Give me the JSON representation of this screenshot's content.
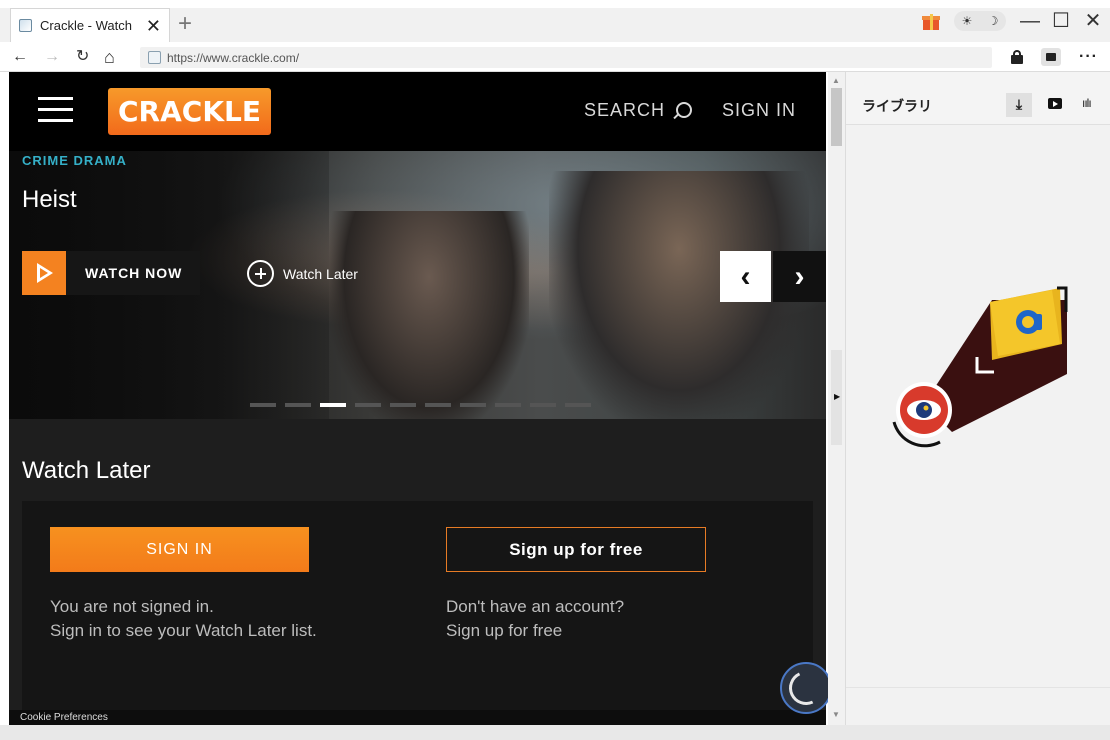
{
  "browser": {
    "tab_title": "Crackle - Watch",
    "tab_close": "✕",
    "new_tab": "+",
    "url": "https://www.crackle.com/",
    "theme_sun": "☀",
    "theme_moon": "☽",
    "win_min": "—",
    "win_max": "☐",
    "win_close": "✕",
    "more": "···",
    "nav_back": "←",
    "nav_forward": "→",
    "nav_reload": "↻",
    "nav_home": "⌂"
  },
  "site": {
    "logo": "CRACKLE",
    "search_label": "SEARCH",
    "signin_label": "SIGN IN"
  },
  "hero": {
    "genre": "CRIME DRAMA",
    "title": "Heist",
    "watch_now": "WATCH NOW",
    "watch_later": "Watch Later",
    "prev": "‹",
    "next": "›",
    "slide_count": 10,
    "active_slide": 3
  },
  "watch_later": {
    "heading": "Watch Later",
    "signin_button": "SIGN IN",
    "signup_button": "Sign up for free",
    "signin_line1": "You are not signed in.",
    "signin_line2": "Sign in to see your Watch Later list.",
    "signup_line1": "Don't have an account?",
    "signup_line2": "Sign up for free"
  },
  "cookie": "Cookie Preferences",
  "sidebar": {
    "title": "ライブラリ",
    "tab_download": "⤓",
    "tab_audio": "ıılı"
  },
  "scrollbar": {
    "up": "▲",
    "down": "▼",
    "toggle": "▶"
  },
  "colors": {
    "accent": "#f48220",
    "genre": "#35b0c8",
    "page_bg": "#1e1e1e"
  }
}
